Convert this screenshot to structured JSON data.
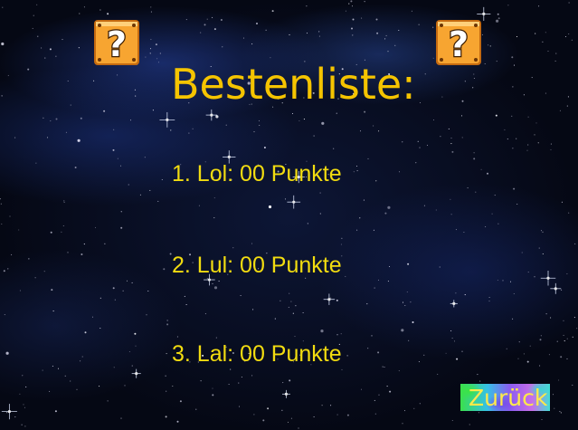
{
  "screen": {
    "title": "Bestenliste:",
    "title_color": "#f5c400",
    "entry_color": "#f2dc10"
  },
  "leaderboard": {
    "entries": [
      {
        "text": "1. Lol: 00 Punkte"
      },
      {
        "text": "2. Lul: 00 Punkte"
      },
      {
        "text": "3. Lal: 00 Punkte"
      }
    ]
  },
  "decorations": {
    "blocks": [
      {
        "icon": "question-block-icon",
        "glyph": "?"
      },
      {
        "icon": "question-block-icon",
        "glyph": "?"
      }
    ]
  },
  "navigation": {
    "back_label": "Zurück"
  },
  "background": {
    "theme": "starfield"
  }
}
